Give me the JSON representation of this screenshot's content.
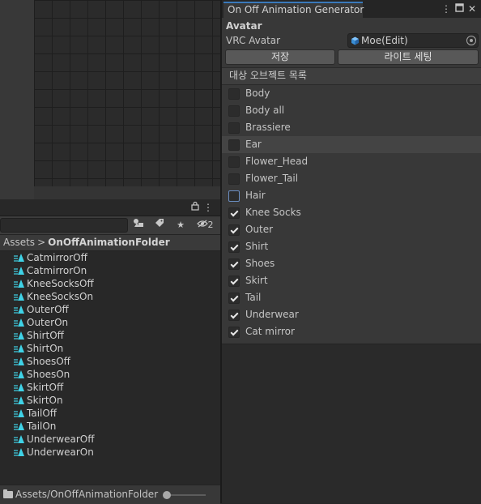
{
  "project": {
    "tab_count_badge": "2",
    "breadcrumb": [
      "Assets",
      "OnOffAnimationFolder"
    ],
    "assets": [
      "CatmirrorOff",
      "CatmirrorOn",
      "KneeSocksOff",
      "KneeSocksOn",
      "OuterOff",
      "OuterOn",
      "ShirtOff",
      "ShirtOn",
      "ShoesOff",
      "ShoesOn",
      "SkirtOff",
      "SkirtOn",
      "TailOff",
      "TailOn",
      "UnderwearOff",
      "UnderwearOn"
    ],
    "footer_path": "Assets/OnOffAnimationFolder",
    "zoom_level": 0.1,
    "asset_icon_color": "#3fd2e6"
  },
  "generator": {
    "window_title": "On Off Animation Generator",
    "section_header": "Avatar",
    "avatar_label": "VRC Avatar",
    "avatar_value": "Moe(Edit)",
    "save_label": "저장",
    "light_setting_label": "라이트 세팅",
    "list_header": "대상 오브젝트 목록",
    "objects": [
      {
        "name": "Body",
        "checked": false
      },
      {
        "name": "Body all",
        "checked": false
      },
      {
        "name": "Brassiere",
        "checked": false
      },
      {
        "name": "Ear",
        "checked": false
      },
      {
        "name": "Flower_Head",
        "checked": false
      },
      {
        "name": "Flower_Tail",
        "checked": false
      },
      {
        "name": "Hair",
        "checked": false
      },
      {
        "name": "Knee Socks",
        "checked": true
      },
      {
        "name": "Outer",
        "checked": true
      },
      {
        "name": "Shirt",
        "checked": true
      },
      {
        "name": "Shoes",
        "checked": true
      },
      {
        "name": "Skirt",
        "checked": true
      },
      {
        "name": "Tail",
        "checked": true
      },
      {
        "name": "Underwear",
        "checked": true
      },
      {
        "name": "Cat mirror",
        "checked": true
      }
    ],
    "hovered_object": "Ear",
    "focused_object": "Hair",
    "accent_color": "#3a79bb"
  }
}
